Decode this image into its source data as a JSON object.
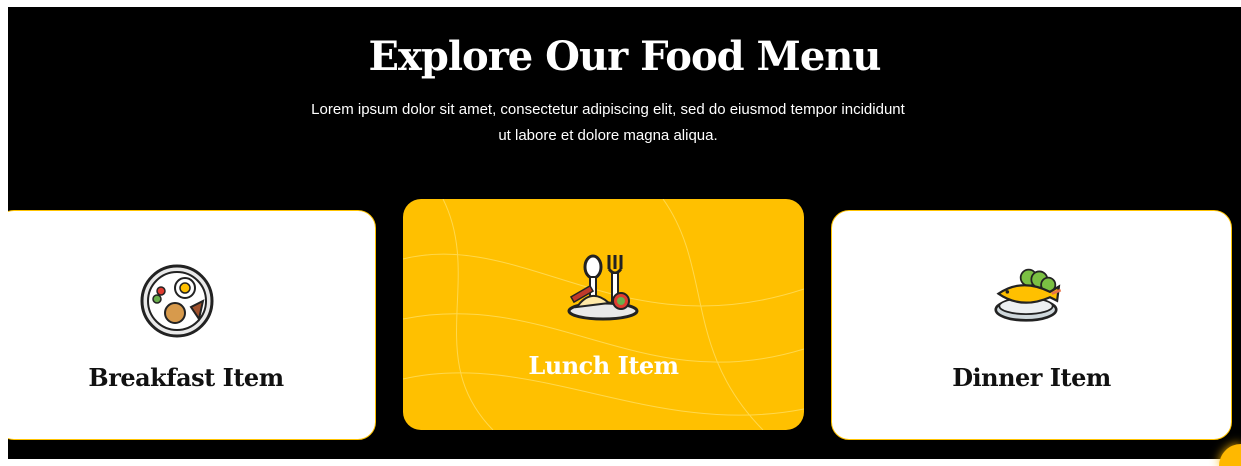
{
  "section": {
    "title": "Explore Our Food Menu",
    "subtitle": "Lorem ipsum dolor sit amet, consectetur adipiscing elit, sed do eiusmod tempor incididunt ut labore et dolore magna aliqua."
  },
  "cards": [
    {
      "label": "Breakfast Item",
      "icon": "breakfast-plate-icon"
    },
    {
      "label": "Lunch Item",
      "icon": "lunch-plate-icon",
      "active": true
    },
    {
      "label": "Dinner Item",
      "icon": "dinner-fish-icon"
    }
  ],
  "colors": {
    "accent": "#ffc000",
    "background": "#000000",
    "card": "#ffffff"
  }
}
